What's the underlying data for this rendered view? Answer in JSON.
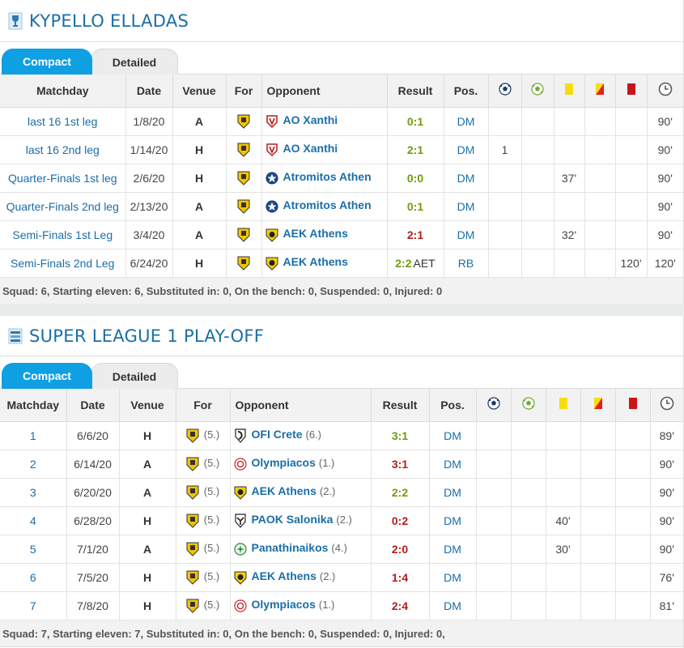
{
  "sections": [
    {
      "title": "KYPELLO ELLADAS",
      "tabs": {
        "compact": "Compact",
        "detailed": "Detailed"
      },
      "headers": {
        "matchday": "Matchday",
        "date": "Date",
        "venue": "Venue",
        "for": "For",
        "opponent": "Opponent",
        "result": "Result",
        "pos": "Pos."
      },
      "rows": [
        {
          "matchday": "last 16 1st leg",
          "date": "1/8/20",
          "venue": "A",
          "opponent": "AO Xanthi",
          "opp_crest": "xanthi",
          "result": "0:1",
          "result_type": "win",
          "aet": "",
          "pos": "DM",
          "goals": "",
          "assists": "",
          "yellow": "",
          "yellowred": "",
          "red": "",
          "minutes": "90'"
        },
        {
          "matchday": "last 16 2nd leg",
          "date": "1/14/20",
          "venue": "H",
          "opponent": "AO Xanthi",
          "opp_crest": "xanthi",
          "result": "2:1",
          "result_type": "win",
          "aet": "",
          "pos": "DM",
          "goals": "1",
          "assists": "",
          "yellow": "",
          "yellowred": "",
          "red": "",
          "minutes": "90'"
        },
        {
          "matchday": "Quarter-Finals 1st leg",
          "date": "2/6/20",
          "venue": "H",
          "opponent": "Atromitos Athen",
          "opp_crest": "atromitos",
          "result": "0:0",
          "result_type": "draw",
          "aet": "",
          "pos": "DM",
          "goals": "",
          "assists": "",
          "yellow": "37'",
          "yellowred": "",
          "red": "",
          "minutes": "90'"
        },
        {
          "matchday": "Quarter-Finals 2nd leg",
          "date": "2/13/20",
          "venue": "A",
          "opponent": "Atromitos Athen",
          "opp_crest": "atromitos",
          "result": "0:1",
          "result_type": "win",
          "aet": "",
          "pos": "DM",
          "goals": "",
          "assists": "",
          "yellow": "",
          "yellowred": "",
          "red": "",
          "minutes": "90'"
        },
        {
          "matchday": "Semi-Finals 1st Leg",
          "date": "3/4/20",
          "venue": "A",
          "opponent": "AEK Athens",
          "opp_crest": "aek",
          "result": "2:1",
          "result_type": "loss",
          "aet": "",
          "pos": "DM",
          "goals": "",
          "assists": "",
          "yellow": "32'",
          "yellowred": "",
          "red": "",
          "minutes": "90'"
        },
        {
          "matchday": "Semi-Finals 2nd Leg",
          "date": "6/24/20",
          "venue": "H",
          "opponent": "AEK Athens",
          "opp_crest": "aek",
          "result": "2:2",
          "result_type": "draw",
          "aet": "AET",
          "pos": "RB",
          "goals": "",
          "assists": "",
          "yellow": "",
          "yellowred": "",
          "red": "120'",
          "minutes": "120'"
        }
      ],
      "footer": "Squad: 6, Starting eleven: 6, Substituted in: 0, On the bench: 0, Suspended: 0, Injured: 0"
    },
    {
      "title": "SUPER LEAGUE 1 PLAY-OFF",
      "tabs": {
        "compact": "Compact",
        "detailed": "Detailed"
      },
      "headers": {
        "matchday": "Matchday",
        "date": "Date",
        "venue": "Venue",
        "for": "For",
        "opponent": "Opponent",
        "result": "Result",
        "pos": "Pos."
      },
      "rows": [
        {
          "matchday": "1",
          "date": "6/6/20",
          "venue": "H",
          "for_rank": "(5.)",
          "opponent": "OFI Crete",
          "opp_rank": "(6.)",
          "opp_crest": "ofi",
          "result": "3:1",
          "result_type": "win",
          "pos": "DM",
          "goals": "",
          "assists": "",
          "yellow": "",
          "yellowred": "",
          "red": "",
          "minutes": "89'"
        },
        {
          "matchday": "2",
          "date": "6/14/20",
          "venue": "A",
          "for_rank": "(5.)",
          "opponent": "Olympiacos",
          "opp_rank": "(1.)",
          "opp_crest": "olympiacos",
          "result": "3:1",
          "result_type": "loss",
          "pos": "DM",
          "goals": "",
          "assists": "",
          "yellow": "",
          "yellowred": "",
          "red": "",
          "minutes": "90'"
        },
        {
          "matchday": "3",
          "date": "6/20/20",
          "venue": "A",
          "for_rank": "(5.)",
          "opponent": "AEK Athens",
          "opp_rank": "(2.)",
          "opp_crest": "aek",
          "result": "2:2",
          "result_type": "draw",
          "pos": "DM",
          "goals": "",
          "assists": "",
          "yellow": "",
          "yellowred": "",
          "red": "",
          "minutes": "90'"
        },
        {
          "matchday": "4",
          "date": "6/28/20",
          "venue": "H",
          "for_rank": "(5.)",
          "opponent": "PAOK Salonika",
          "opp_rank": "(2.)",
          "opp_crest": "paok",
          "result": "0:2",
          "result_type": "loss",
          "pos": "DM",
          "goals": "",
          "assists": "",
          "yellow": "40'",
          "yellowred": "",
          "red": "",
          "minutes": "90'"
        },
        {
          "matchday": "5",
          "date": "7/1/20",
          "venue": "A",
          "for_rank": "(5.)",
          "opponent": "Panathinaikos",
          "opp_rank": "(4.)",
          "opp_crest": "pao",
          "result": "2:0",
          "result_type": "loss",
          "pos": "DM",
          "goals": "",
          "assists": "",
          "yellow": "30'",
          "yellowred": "",
          "red": "",
          "minutes": "90'"
        },
        {
          "matchday": "6",
          "date": "7/5/20",
          "venue": "H",
          "for_rank": "(5.)",
          "opponent": "AEK Athens",
          "opp_rank": "(2.)",
          "opp_crest": "aek",
          "result": "1:4",
          "result_type": "loss",
          "pos": "DM",
          "goals": "",
          "assists": "",
          "yellow": "",
          "yellowred": "",
          "red": "",
          "minutes": "76'"
        },
        {
          "matchday": "7",
          "date": "7/8/20",
          "venue": "H",
          "for_rank": "(5.)",
          "opponent": "Olympiacos",
          "opp_rank": "(1.)",
          "opp_crest": "olympiacos",
          "result": "2:4",
          "result_type": "loss",
          "pos": "DM",
          "goals": "",
          "assists": "",
          "yellow": "",
          "yellowred": "",
          "red": "",
          "minutes": "81'"
        }
      ],
      "footer": "Squad: 7, Starting eleven: 7, Substituted in: 0, On the bench: 0, Suspended: 0, Injured: 0,"
    }
  ],
  "icons": {
    "goals": "football-icon",
    "assists": "assist-icon",
    "yellow": "yellow-card-icon",
    "yellowred": "second-yellow-card-icon",
    "red": "red-card-icon",
    "minutes": "clock-icon"
  },
  "colors": {
    "link": "#1a6ea8",
    "tab_active": "#0fa0e3",
    "win": "#6f9c0b",
    "loss": "#b81a1a"
  }
}
